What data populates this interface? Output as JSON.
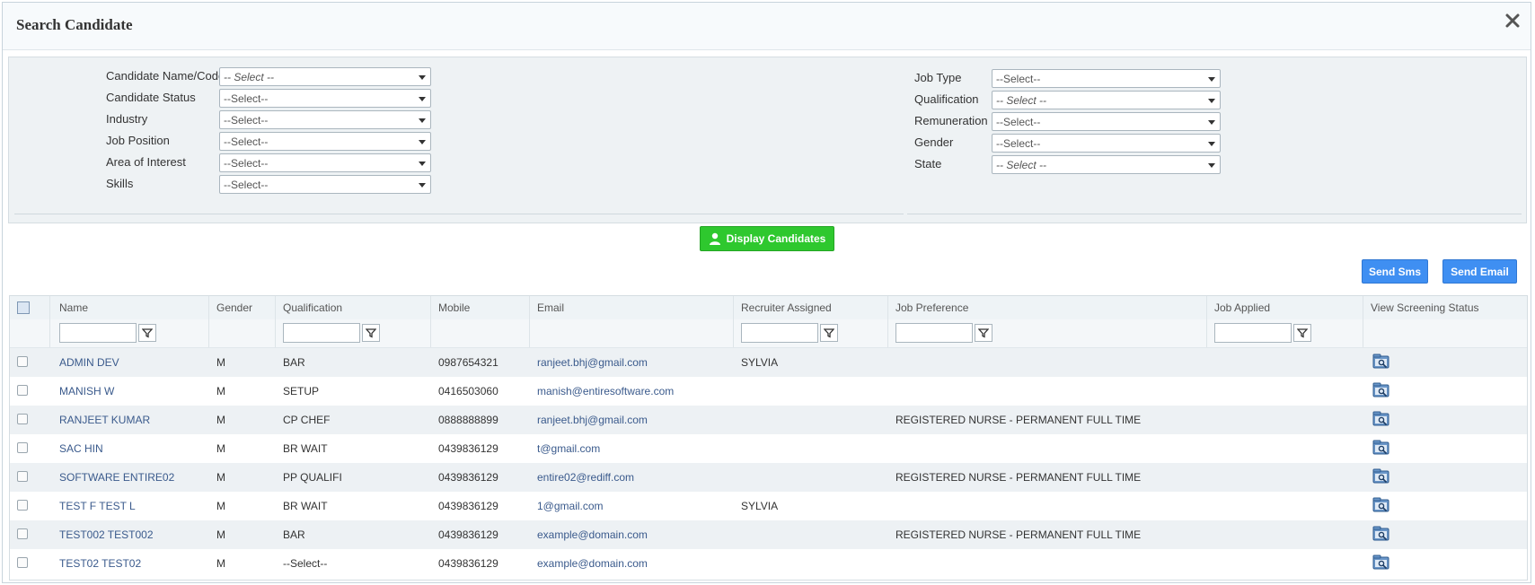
{
  "dialog": {
    "title": "Search Candidate",
    "close_icon": "close-icon"
  },
  "filters": {
    "left": [
      {
        "label": "Candidate Name/Code",
        "value": "-- Select --",
        "italic": true
      },
      {
        "label": "Candidate Status",
        "value": "--Select--",
        "italic": false
      },
      {
        "label": "Industry",
        "value": "--Select--",
        "italic": false
      },
      {
        "label": "Job Position",
        "value": "--Select--",
        "italic": false
      },
      {
        "label": "Area of Interest",
        "value": "--Select--",
        "italic": false
      },
      {
        "label": "Skills",
        "value": "--Select--",
        "italic": false
      }
    ],
    "right": [
      {
        "label": "Job Type",
        "value": "--Select--",
        "italic": false
      },
      {
        "label": "Qualification",
        "value": "-- Select --",
        "italic": true
      },
      {
        "label": "Remuneration",
        "value": "--Select--",
        "italic": false
      },
      {
        "label": "Gender",
        "value": "--Select--",
        "italic": false
      },
      {
        "label": "State",
        "value": "-- Select --",
        "italic": true
      }
    ]
  },
  "actions": {
    "display_label": "Display Candidates",
    "send_sms_label": "Send Sms",
    "send_email_label": "Send Email"
  },
  "grid": {
    "columns": {
      "name": "Name",
      "gender": "Gender",
      "qualification": "Qualification",
      "mobile": "Mobile",
      "email": "Email",
      "recruiter": "Recruiter Assigned",
      "job_preference": "Job Preference",
      "job_applied": "Job Applied",
      "screening": "View Screening Status"
    },
    "rows": [
      {
        "name": "ADMIN DEV",
        "gender": "M",
        "qualification": "BAR",
        "mobile": "0987654321",
        "email": "ranjeet.bhj@gmail.com",
        "recruiter": "SYLVIA",
        "job_preference": "",
        "job_applied": ""
      },
      {
        "name": "MANISH W",
        "gender": "M",
        "qualification": "SETUP",
        "mobile": "0416503060",
        "email": "manish@entiresoftware.com",
        "recruiter": "",
        "job_preference": "",
        "job_applied": ""
      },
      {
        "name": "RANJEET KUMAR",
        "gender": "M",
        "qualification": "CP CHEF",
        "mobile": "0888888899",
        "email": "ranjeet.bhj@gmail.com",
        "recruiter": "",
        "job_preference": "REGISTERED NURSE - PERMANENT FULL TIME",
        "job_applied": ""
      },
      {
        "name": "SAC HIN",
        "gender": "M",
        "qualification": "BR WAIT",
        "mobile": "0439836129",
        "email": "t@gmail.com",
        "recruiter": "",
        "job_preference": "",
        "job_applied": ""
      },
      {
        "name": "SOFTWARE ENTIRE02",
        "gender": "M",
        "qualification": "PP QUALIFI",
        "mobile": "0439836129",
        "email": "entire02@rediff.com",
        "recruiter": "",
        "job_preference": "REGISTERED NURSE - PERMANENT FULL TIME",
        "job_applied": ""
      },
      {
        "name": "TEST F TEST L",
        "gender": "M",
        "qualification": "BR WAIT",
        "mobile": "0439836129",
        "email": "1@gmail.com",
        "recruiter": "SYLVIA",
        "job_preference": "",
        "job_applied": ""
      },
      {
        "name": "TEST002 TEST002",
        "gender": "M",
        "qualification": "BAR",
        "mobile": "0439836129",
        "email": "example@domain.com",
        "recruiter": "",
        "job_preference": "REGISTERED NURSE - PERMANENT FULL TIME",
        "job_applied": ""
      },
      {
        "name": "TEST02 TEST02",
        "gender": "M",
        "qualification": "--Select--",
        "mobile": "0439836129",
        "email": "example@domain.com",
        "recruiter": "",
        "job_preference": "",
        "job_applied": ""
      }
    ]
  },
  "colors": {
    "display_button": "#2ec82e",
    "blue_button": "#3f8ff2",
    "link": "#3a5a8c",
    "row_alt": "#edf1f4"
  }
}
